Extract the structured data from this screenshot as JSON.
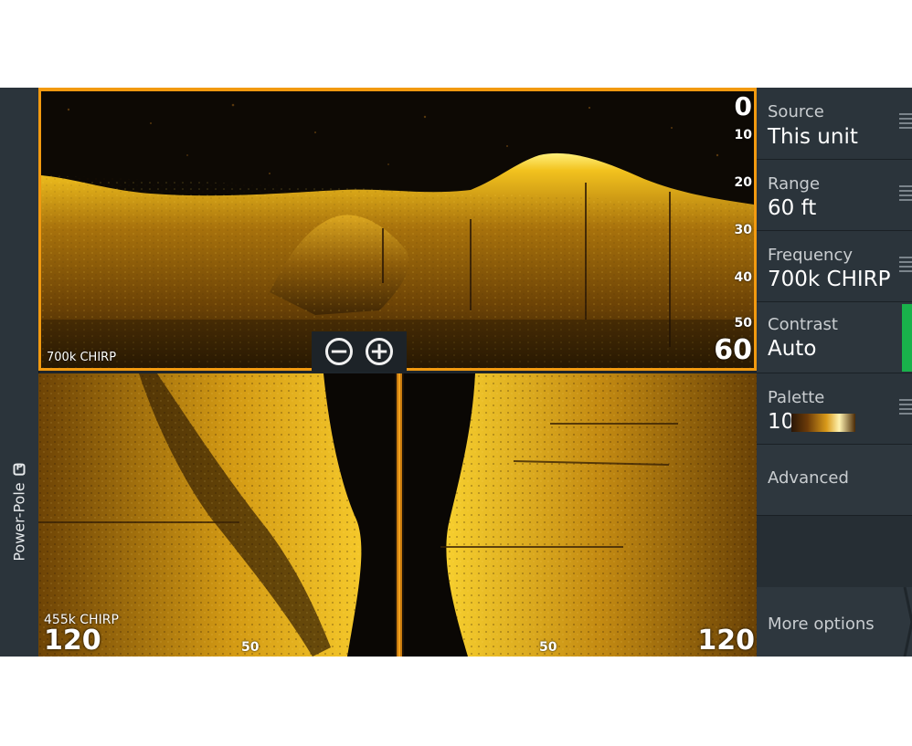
{
  "side_strip": {
    "label": "Power-Pole",
    "icon": "power-pole-icon"
  },
  "down_view": {
    "depth_top": "0",
    "depth_ticks": [
      "10",
      "20",
      "30",
      "40",
      "50"
    ],
    "depth_bottom": "60",
    "frequency": "700k CHIRP",
    "zoom_out_label": "−",
    "zoom_in_label": "+"
  },
  "side_view": {
    "frequency": "455k CHIRP",
    "range_left": "120",
    "range_right": "120",
    "mid_left": "50",
    "mid_right": "50"
  },
  "menu": {
    "source": {
      "label": "Source",
      "value": "This unit"
    },
    "range": {
      "label": "Range",
      "value": "60 ft"
    },
    "frequency": {
      "label": "Frequency",
      "value": "700k CHIRP"
    },
    "contrast": {
      "label": "Contrast",
      "value": "Auto"
    },
    "palette": {
      "label": "Palette",
      "value": "10"
    },
    "advanced": {
      "label": "Advanced"
    },
    "more": {
      "label": "More options"
    }
  },
  "colors": {
    "accent_orange": "#f29a10",
    "active_green": "#19b24b",
    "sonar_gold": "#e8b413"
  }
}
